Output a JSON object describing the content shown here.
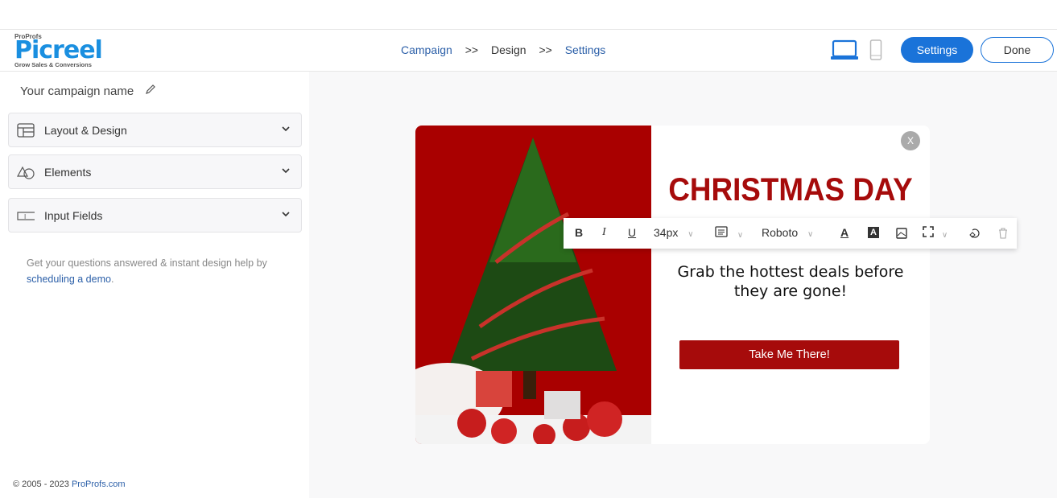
{
  "header": {
    "logo_top": "ProProfs",
    "logo_main": "Picreel",
    "logo_tagline": "Grow Sales & Conversions",
    "breadcrumb": [
      {
        "label": "Campaign"
      },
      {
        "label": ">>"
      },
      {
        "label": "Design"
      },
      {
        "label": ">>"
      },
      {
        "label": "Settings"
      }
    ],
    "settings_label": "Settings",
    "done_label": "Done",
    "accent": "#1a73d9"
  },
  "sidebar": {
    "campaign_name": "Your campaign name",
    "sections": [
      {
        "label": "Layout & Design",
        "icon": "layout-icon"
      },
      {
        "label": "Elements",
        "icon": "shapes-icon"
      },
      {
        "label": "Input Fields",
        "icon": "input-field-icon"
      }
    ],
    "help_text": "Get your questions answered & instant design help by ",
    "help_link": "scheduling a demo",
    "help_end": ".",
    "footer_text": "© 2005 - 2023 ",
    "footer_link": "ProProfs.com"
  },
  "popup": {
    "title": "CHRISTMAS DAY",
    "subtitle": "Grab the hottest deals before they are gone!",
    "cta": "Take Me There!",
    "close": "X",
    "accent": "#a60b0b"
  },
  "toolbar": {
    "bold": "B",
    "italic": "I",
    "underline": "U",
    "font_size": "34px",
    "font_family": "Roboto"
  }
}
